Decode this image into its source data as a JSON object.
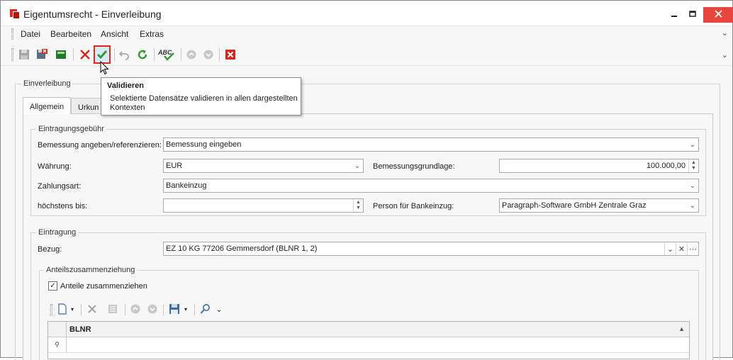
{
  "window": {
    "title": "Eigentumsrecht - Einverleibung",
    "minimize": "🗕",
    "maximize": "🗖",
    "close": "✕"
  },
  "menu": {
    "items": [
      "Datei",
      "Bearbeiten",
      "Ansicht",
      "Extras"
    ]
  },
  "toolbar": {
    "icons": [
      "save-icon",
      "save-close-icon",
      "green-square-icon",
      "discard-icon",
      "validate-icon",
      "undo-icon",
      "refresh-icon",
      "spellcheck-icon",
      "up-icon",
      "down-icon",
      "close-red-icon"
    ],
    "active": "validate-icon"
  },
  "tooltip": {
    "title": "Validieren",
    "body": "Selektierte Datensätze validieren in allen dargestellten Kontexten"
  },
  "group": {
    "label": "Einverleibung"
  },
  "tabs": [
    {
      "label": "Allgemein",
      "selected": true
    },
    {
      "label": "Urkun",
      "selected": false
    }
  ],
  "gebuehr": {
    "legend": "Eintragungsgebühr",
    "bemessung_label": "Bemessung angeben/referenzieren:",
    "bemessung_value": "Bemessung eingeben",
    "waehrung_label": "Währung:",
    "waehrung_value": "EUR",
    "grundlage_label": "Bemessungsgrundlage:",
    "grundlage_value": "100.000,00",
    "zahlungsart_label": "Zahlungsart:",
    "zahlungsart_value": "Bankeinzug",
    "hoechstens_label": "höchstens bis:",
    "hoechstens_value": "",
    "person_label": "Person für Bankeinzug:",
    "person_value": "Paragraph-Software GmbH Zentrale Graz"
  },
  "eintragung": {
    "legend": "Eintragung",
    "bezug_label": "Bezug:",
    "bezug_value": "EZ 10 KG 77206 Gemmersdorf (BLNR 1, 2)"
  },
  "anteil": {
    "legend": "Anteilszusammenziehung",
    "checkbox_label": "Anteile zusammenziehen",
    "checked": true
  },
  "grid": {
    "column": "BLNR"
  },
  "colors": {
    "accent_red": "#e0281c",
    "highlight": "#d7e9f7"
  }
}
